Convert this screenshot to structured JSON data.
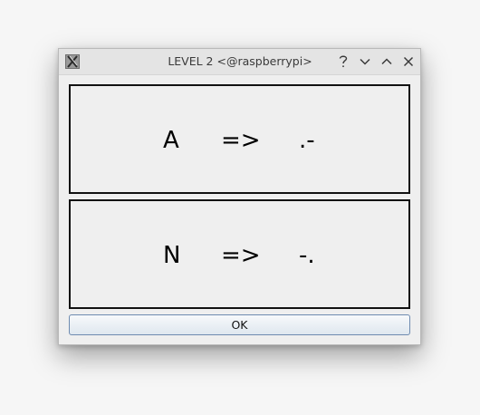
{
  "window": {
    "title": "LEVEL 2 <@raspberrypi>",
    "app_icon": "x11-app-icon",
    "controls": {
      "help": "help-icon",
      "minimize": "chevron-down-icon",
      "maximize": "chevron-up-icon",
      "close": "close-icon"
    }
  },
  "rows": [
    {
      "letter": "A",
      "arrow": "=>",
      "code": ".-"
    },
    {
      "letter": "N",
      "arrow": "=>",
      "code": "-."
    }
  ],
  "buttons": {
    "ok_label": "OK"
  },
  "colors": {
    "titlebar": "#e4e4e4",
    "window_bg": "#efefef",
    "panel_border": "#111111",
    "button_border": "#6e8bb0"
  }
}
